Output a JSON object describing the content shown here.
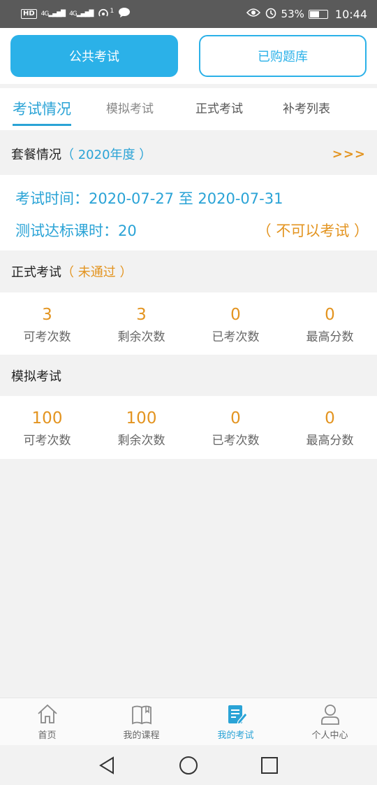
{
  "status_bar": {
    "hd": "HD",
    "signal1": "4G",
    "signal2": "4G",
    "wifi_badge": "1",
    "battery": "53%",
    "time": "10:44"
  },
  "top_tabs": [
    {
      "label": "公共考试",
      "active": true
    },
    {
      "label": "已购题库",
      "active": false
    }
  ],
  "sub_tabs": [
    {
      "label": "考试情况",
      "active": true
    },
    {
      "label": "模拟考试",
      "active": false
    },
    {
      "label": "正式考试",
      "active": false
    },
    {
      "label": "补考列表",
      "active": false
    }
  ],
  "package": {
    "title": "套餐情况",
    "year_label": "（ 2020年度 ）",
    "more": ">>>",
    "exam_time": "考试时间：2020-07-27 至 2020-07-31",
    "study_hours": "测试达标课时：20",
    "status": "（ 不可以考试 ）"
  },
  "formal_exam": {
    "title": "正式考试",
    "result": "（ 未通过 ）",
    "stats": [
      {
        "value": "3",
        "label": "可考次数"
      },
      {
        "value": "3",
        "label": "剩余次数"
      },
      {
        "value": "0",
        "label": "已考次数"
      },
      {
        "value": "0",
        "label": "最高分数"
      }
    ]
  },
  "mock_exam": {
    "title": "模拟考试",
    "stats": [
      {
        "value": "100",
        "label": "可考次数"
      },
      {
        "value": "100",
        "label": "剩余次数"
      },
      {
        "value": "0",
        "label": "已考次数"
      },
      {
        "value": "0",
        "label": "最高分数"
      }
    ]
  },
  "bottom_nav": [
    {
      "label": "首页",
      "icon": "home-icon",
      "active": false
    },
    {
      "label": "我的课程",
      "icon": "book-icon",
      "active": false
    },
    {
      "label": "我的考试",
      "icon": "exam-icon",
      "active": true
    },
    {
      "label": "个人中心",
      "icon": "person-icon",
      "active": false
    }
  ],
  "colors": {
    "primary": "#2bb1e8",
    "accent": "#e39420",
    "text_blue": "#2aa3d6"
  }
}
